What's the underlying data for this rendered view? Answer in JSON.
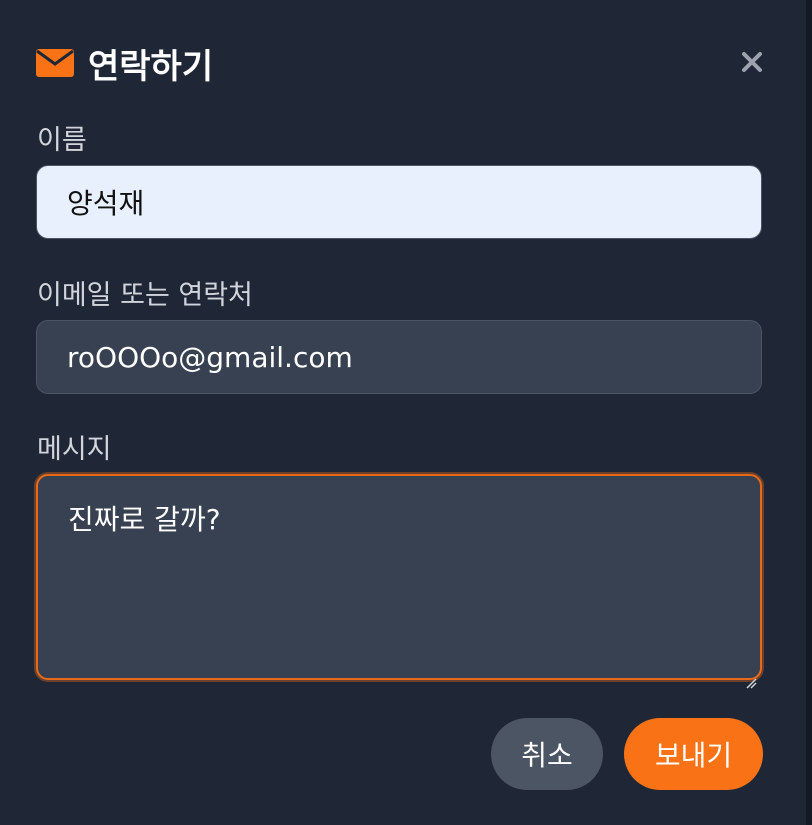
{
  "dialog": {
    "title": "연락하기",
    "title_icon": "envelope-icon",
    "close_icon": "close-icon"
  },
  "form": {
    "name": {
      "label": "이름",
      "value": "양석재"
    },
    "contact": {
      "label": "이메일 또는 연락처",
      "value": "roOOOo@gmail.com"
    },
    "message": {
      "label": "메시지",
      "value": "진짜로 갈까?"
    }
  },
  "actions": {
    "cancel_label": "취소",
    "send_label": "보내기"
  },
  "colors": {
    "background": "#1f2737",
    "accent": "#f97316",
    "input_bg": "#374151",
    "autofill_bg": "#e8f0fe",
    "cancel_bg": "#4b5563"
  }
}
